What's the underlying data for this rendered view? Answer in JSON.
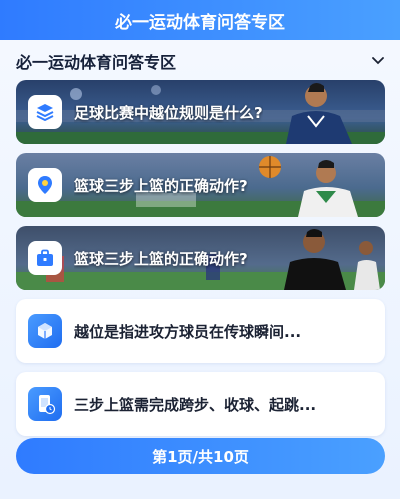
{
  "header": {
    "title": "必一运动体育问答专区"
  },
  "section": {
    "title": "必一运动体育问答专区"
  },
  "cards": [
    {
      "label": "足球比赛中越位规则是什么?",
      "icon": "layers-icon"
    },
    {
      "label": "篮球三步上篮的正确动作?",
      "icon": "location-pin-icon"
    },
    {
      "label": "篮球三步上篮的正确动作?",
      "icon": "briefcase-icon"
    },
    {
      "label": "越位是指进攻方球员在传球瞬间...",
      "icon": "cube-icon"
    },
    {
      "label": "三步上篮需完成跨步、收球、起跳...",
      "icon": "phone-clock-icon"
    }
  ],
  "pager": {
    "label": "第1页/共10页"
  },
  "colors": {
    "accent": "#2f7bff",
    "accent_light": "#4aa0ff"
  }
}
